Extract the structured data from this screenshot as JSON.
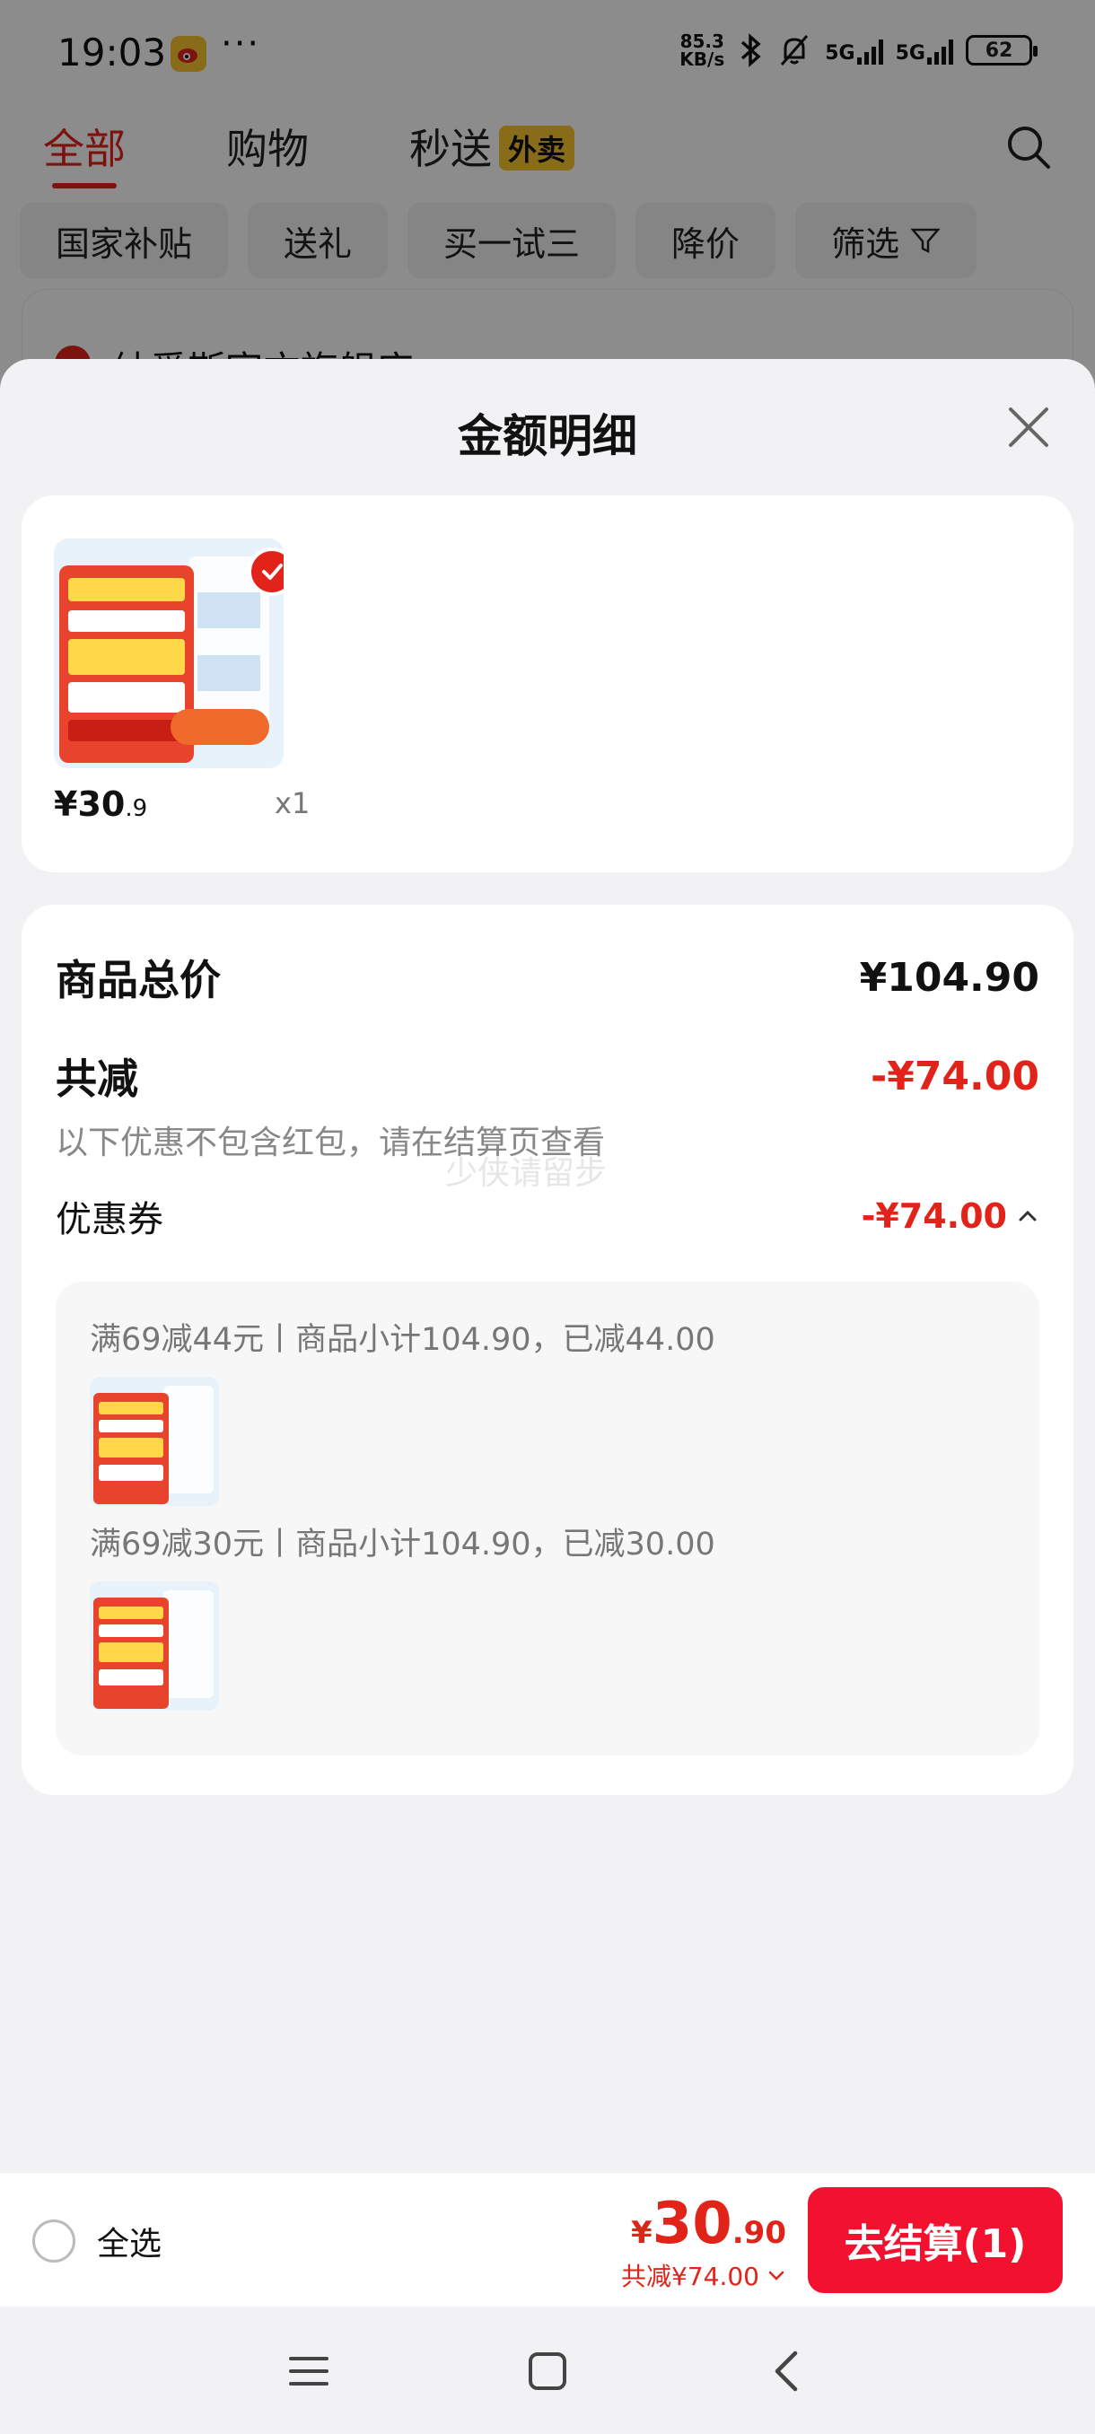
{
  "status_bar": {
    "time": "19:03",
    "dots": "···",
    "net_speed_value": "85.3",
    "net_speed_unit": "KB/s",
    "signal1": "5G",
    "signal2": "5G",
    "battery": "62"
  },
  "top_tabs": [
    {
      "label": "全部",
      "active": true
    },
    {
      "label": "购物",
      "active": false
    },
    {
      "label": "秒送",
      "badge": "外卖",
      "active": false
    }
  ],
  "filters": [
    "国家补贴",
    "送礼",
    "买一试三",
    "降价",
    "筛选"
  ],
  "background_card": {
    "shop_name": "纳爱斯官方旗舰店"
  },
  "sheet": {
    "title": "金额明细",
    "product": {
      "price_int": "¥30",
      "price_dec": ".9",
      "qty": "x1"
    },
    "summary": {
      "total_label": "商品总价",
      "total_value": "¥104.90",
      "discount_label": "共减",
      "discount_value": "-¥74.00",
      "hint": "以下优惠不包含红包，请在结算页查看",
      "watermark": "少侠请留步"
    },
    "coupon": {
      "label": "优惠券",
      "value": "-¥74.00",
      "items": [
        {
          "text": "满69减44元丨商品小计104.90，已减44.00"
        },
        {
          "text": "满69减30元丨商品小计104.90，已减30.00"
        }
      ]
    }
  },
  "bottom_bar": {
    "select_all": "全选",
    "price_cur": "¥",
    "price_int": "30",
    "price_dec": ".90",
    "saved": "共减¥74.00",
    "checkout": "去结算(1)"
  },
  "colors": {
    "accent": "#e2231a",
    "checkout": "#f2122f",
    "badge": "#f7c531"
  }
}
